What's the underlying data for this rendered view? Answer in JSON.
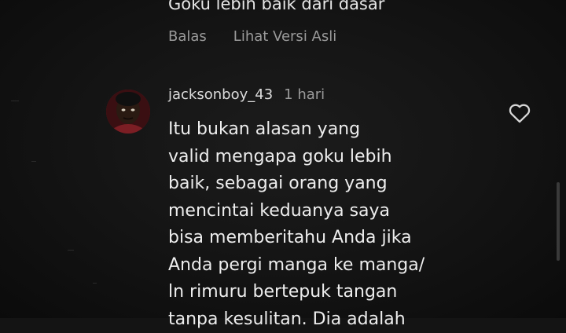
{
  "previous_comment": {
    "text": "Goku lebih baik dari dasar"
  },
  "actions": {
    "reply_label": "Balas",
    "see_original_label": "Lihat Versi Asli"
  },
  "comment": {
    "username": "jacksonboy_43",
    "time": "1 hari",
    "text": "Itu bukan alasan yang\nvalid mengapa goku lebih\nbaik, sebagai orang yang\nmencintai keduanya saya\nbisa memberitahu Anda jika\nAnda pergi manga ke manga/\nln rimuru bertepuk tangan\ntanpa kesulitan. Dia adalah",
    "avatar_icon": "user-avatar",
    "like_icon": "heart-outline-icon"
  },
  "colors": {
    "background": "#141414",
    "text_primary": "#ededed",
    "text_secondary": "#9a9a9a",
    "avatar_bg": "#6a1c20"
  }
}
